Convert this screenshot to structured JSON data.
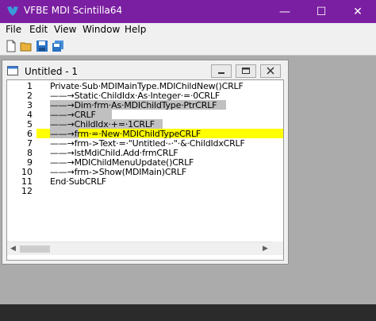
{
  "app": {
    "title": "VFBE MDI Scintilla64",
    "accent": "#7b1fa2"
  },
  "window_controls": {
    "minimize": "—",
    "maximize": "☐",
    "close": "✕"
  },
  "menu": [
    "File",
    "Edit",
    "View",
    "Window",
    "Help"
  ],
  "toolbar": [
    "new-file-icon",
    "open-folder-icon",
    "save-icon",
    "save-all-icon"
  ],
  "mdi": {
    "title": "Untitled - 1"
  },
  "editor": {
    "line_numbers": [
      "1",
      "2",
      "3",
      "4",
      "5",
      "6",
      "7",
      "8",
      "9",
      "10",
      "11",
      "12"
    ],
    "lines": [
      "Private·Sub·MDIMainType.MDIChildNew()CRLF",
      "——→Static·ChildIdx·As·Integer·=·0CRLF",
      "——→Dim·frm·As·MDIChildType·PtrCRLF",
      "——→CRLF",
      "——→ChildIdx·+=·1CRLF",
      "——→frm·=·New·MDIChildTypeCRLF",
      "——→frm->Text·=·\"Untitled·-·\"·&·ChildIdxCRLF",
      "——→lstMdiChild.Add·frmCRLF",
      "——→MDIChildMenuUpdate()CRLF",
      "——→frm->Show(MDIMain)CRLF",
      "End·SubCRLF",
      ""
    ],
    "current_line_color": "#ffff00",
    "selection_color": "#c0c0c0"
  }
}
